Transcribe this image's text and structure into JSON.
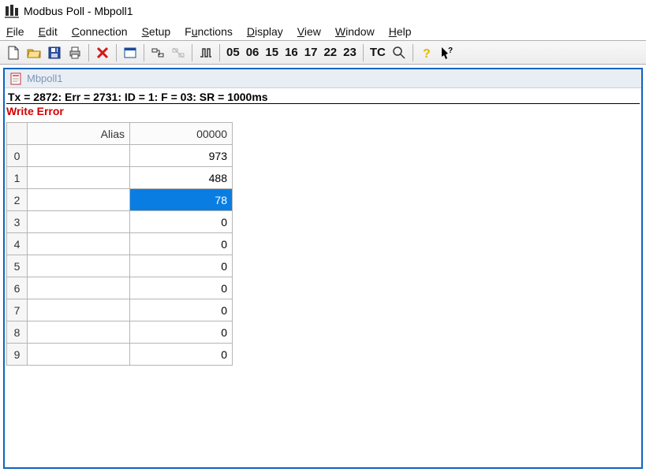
{
  "window": {
    "title": "Modbus Poll - Mbpoll1"
  },
  "menu": {
    "file": "File",
    "edit": "Edit",
    "connection": "Connection",
    "setup": "Setup",
    "functions": "Functions",
    "display": "Display",
    "view": "View",
    "window": "Window",
    "help": "Help"
  },
  "toolbar": {
    "fcodes": [
      "05",
      "06",
      "15",
      "16",
      "17",
      "22",
      "23"
    ],
    "tc_label": "TC"
  },
  "document": {
    "title": "Mbpoll1",
    "status": "Tx = 2872: Err = 2731: ID = 1: F = 03: SR = 1000ms",
    "error": "Write Error"
  },
  "table": {
    "headers": {
      "alias": "Alias",
      "value": "00000"
    },
    "rows": [
      {
        "idx": "0",
        "alias": "",
        "value": "973",
        "selected": false
      },
      {
        "idx": "1",
        "alias": "",
        "value": "488",
        "selected": false
      },
      {
        "idx": "2",
        "alias": "",
        "value": "78",
        "selected": true
      },
      {
        "idx": "3",
        "alias": "",
        "value": "0",
        "selected": false
      },
      {
        "idx": "4",
        "alias": "",
        "value": "0",
        "selected": false
      },
      {
        "idx": "5",
        "alias": "",
        "value": "0",
        "selected": false
      },
      {
        "idx": "6",
        "alias": "",
        "value": "0",
        "selected": false
      },
      {
        "idx": "7",
        "alias": "",
        "value": "0",
        "selected": false
      },
      {
        "idx": "8",
        "alias": "",
        "value": "0",
        "selected": false
      },
      {
        "idx": "9",
        "alias": "",
        "value": "0",
        "selected": false
      }
    ]
  }
}
